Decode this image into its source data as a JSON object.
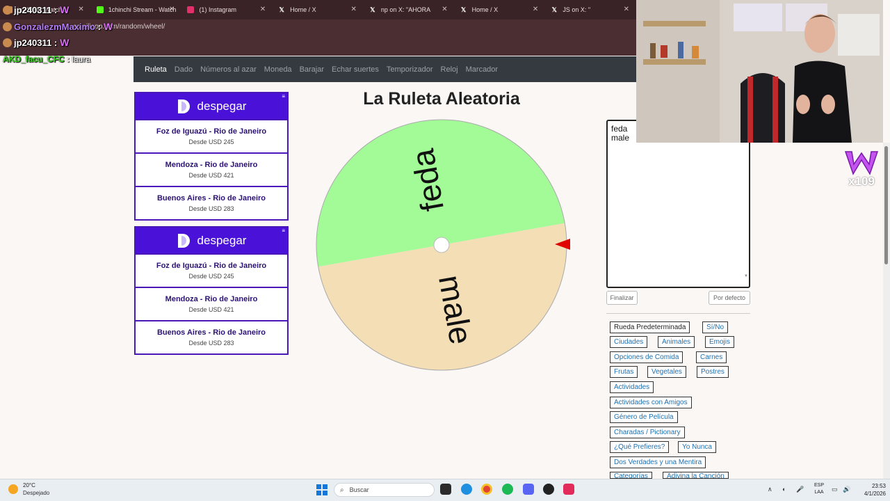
{
  "browser": {
    "tabs": [
      {
        "label": "jp240311 Watch Li",
        "icon_color": "#c88a4e"
      },
      {
        "label": "1chinchi Stream - Watch",
        "icon_color": "#53fc18"
      },
      {
        "label": "(1) Instagram",
        "icon_color": "#e1306c"
      },
      {
        "label": "Home / X",
        "icon_color": "#ffffff"
      },
      {
        "label": "np on X: \"AHORA",
        "icon_color": "#ffffff"
      },
      {
        "label": "Home / X",
        "icon_color": "#ffffff"
      },
      {
        "label": "JS on X: \"",
        "icon_color": "#ffffff"
      }
    ],
    "address": "es.piliapp.com/random/wheel/",
    "close_glyph": "✕"
  },
  "chat": [
    {
      "user": "jp240311",
      "message": "",
      "color": "#ffffff"
    },
    {
      "user": "GonzalezmMaximo",
      "message": "",
      "color": "#b57cf5"
    },
    {
      "user": "jp240311",
      "message": "",
      "color": "#ffffff"
    },
    {
      "user": "AKD_facu_CFC",
      "message": "laura",
      "color": "#37d61b"
    }
  ],
  "nav": {
    "items": [
      "Ruleta",
      "Dado",
      "Números al azar",
      "Moneda",
      "Barajar",
      "Echar suertes",
      "Temporizador",
      "Reloj",
      "Marcador"
    ],
    "active": 0
  },
  "ads": [
    {
      "brand": "despegar",
      "routes": [
        {
          "route": "Foz de Iguazú - Rio de Janeiro",
          "price": "Desde USD 245"
        },
        {
          "route": "Mendoza - Rio de Janeiro",
          "price": "Desde USD 421"
        },
        {
          "route": "Buenos Aires - Rio de Janeiro",
          "price": "Desde USD 283"
        }
      ]
    },
    {
      "brand": "despegar",
      "routes": [
        {
          "route": "Foz de Iguazú - Rio de Janeiro",
          "price": "Desde USD 245"
        },
        {
          "route": "Mendoza - Rio de Janeiro",
          "price": "Desde USD 421"
        },
        {
          "route": "Buenos Aires - Rio de Janeiro",
          "price": "Desde USD 283"
        }
      ]
    }
  ],
  "wheel": {
    "title": "La Ruleta Aleatoria",
    "segments": [
      {
        "label": "feda",
        "color": "#a3fb98"
      },
      {
        "label": "male",
        "color": "#f3deb6"
      }
    ],
    "pointer_color": "#e00000"
  },
  "editor": {
    "entries": "feda\nmale",
    "finish_label": "Finalizar",
    "default_label": "Por defecto"
  },
  "presets": [
    "Rueda Predeterminada",
    "Sí/No",
    "Ciudades",
    "Animales",
    "Emojis",
    "Opciones de Comida",
    "Carnes",
    "Frutas",
    "Vegetales",
    "Postres",
    "Actividades",
    "Actividades con Amigos",
    "Género de Película",
    "Charadas / Pictionary",
    "¿Qué Prefieres?",
    "Yo Nunca",
    "Dos Verdades y una Mentira",
    "Categorías",
    "Adivina la Canción"
  ],
  "stream_badge": {
    "label": "x109"
  },
  "taskbar": {
    "weather_temp": "20°C",
    "weather_desc": "Despejado",
    "search_placeholder": "Buscar",
    "lang_top": "ESP",
    "lang_bottom": "LAA",
    "time": "23:53",
    "date": "4/1/2026",
    "tray_up": "∧",
    "tray_icons": [
      "◐",
      "🎤",
      "▭",
      "🔊",
      "🔋"
    ]
  }
}
